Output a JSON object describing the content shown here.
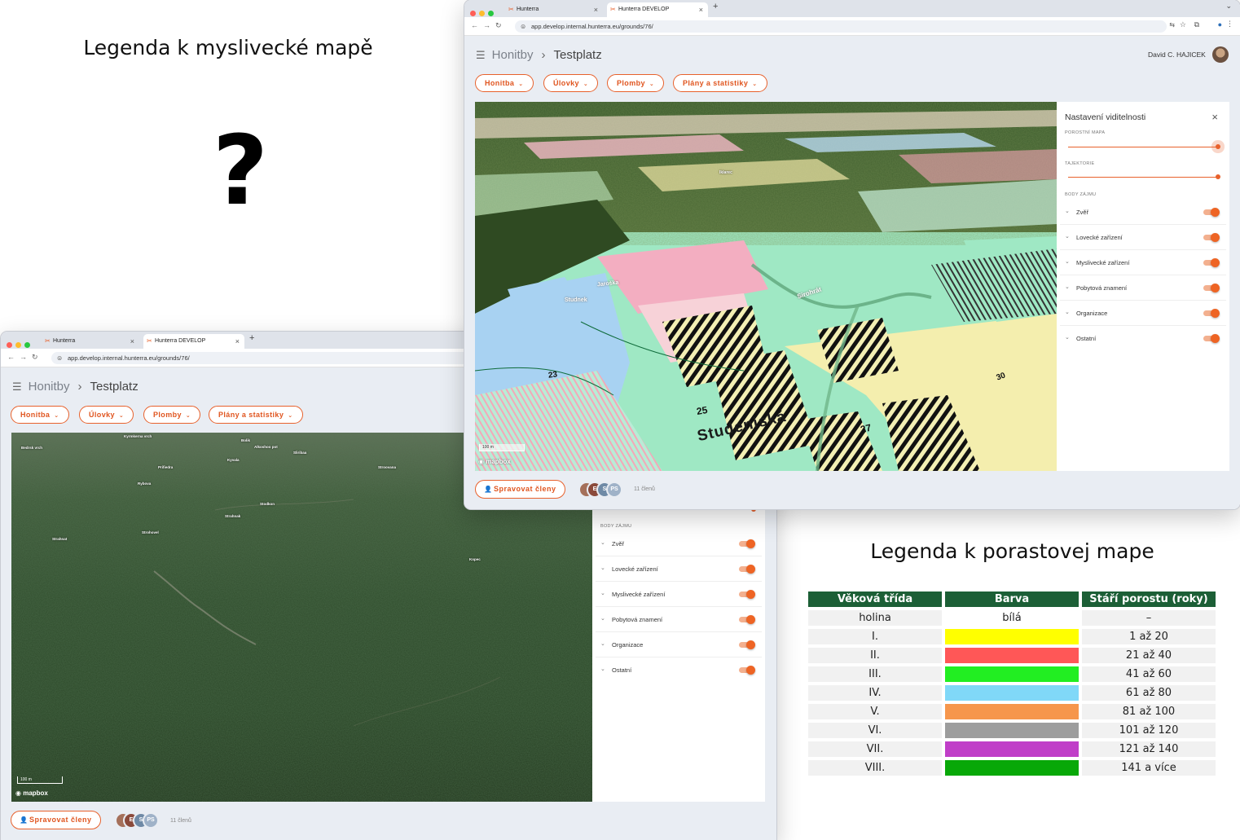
{
  "headings": {
    "left_title": "Legenda k myslivecké mapě",
    "question_mark": "?",
    "right_title": "Legenda k porastovej mape"
  },
  "colors": {
    "accent": "#e8612c",
    "table_header": "#1c5f36"
  },
  "browser_back": {
    "tabs": [
      {
        "label": "Hunterra",
        "icon": "hunterra-logo-icon"
      },
      {
        "label": "Hunterra DEVELOP",
        "icon": "hunterra-logo-icon"
      }
    ],
    "url": "app.develop.internal.hunterra.eu/grounds/76/"
  },
  "browser_front": {
    "tabs": [
      {
        "label": "Hunterra",
        "icon": "hunterra-logo-icon"
      },
      {
        "label": "Hunterra DEVELOP",
        "icon": "hunterra-logo-icon"
      }
    ],
    "url": "app.develop.internal.hunterra.eu/grounds/76/",
    "user_name": "David C. HAJICEK"
  },
  "app": {
    "breadcrumb": {
      "root": "Honitby",
      "current": "Testplatz"
    },
    "menu": [
      {
        "label": "Honitba"
      },
      {
        "label": "Úlovky"
      },
      {
        "label": "Plomby"
      },
      {
        "label": "Plány a statistiky"
      }
    ],
    "manage_members_label": "Spravovat členy",
    "members_count": "11 členů",
    "member_initials": [
      "E",
      "S",
      "PS"
    ],
    "scale_label": "100 m",
    "mapbox_label": "mapbox"
  },
  "visibility_panel": {
    "title": "Nastavení viditelnosti",
    "layers": [
      {
        "label": "POROSTNÍ MAPA",
        "value": 1.0
      },
      {
        "label": "TAJEKTORIE",
        "value": 1.0
      }
    ],
    "poi_label": "BODY ZÁJMU",
    "poi": [
      {
        "label": "Zvěř",
        "on": true
      },
      {
        "label": "Lovecké zařízení",
        "on": true
      },
      {
        "label": "Myslivecké zařízení",
        "on": true
      },
      {
        "label": "Pobytová znamení",
        "on": true
      },
      {
        "label": "Organizace",
        "on": true
      },
      {
        "label": "Ostatní",
        "on": true
      }
    ]
  },
  "map_labels_satellite": [
    "Bedrsk vrch",
    "Kyrmkerna vrch",
    "Bolik",
    "Alkoshoo pot",
    "Sliribaa",
    "Kyvala",
    "Prifiedra",
    "Stroovana",
    "Rybova",
    "Strahnak",
    "Stodkon",
    "Kopec",
    "Strohovel",
    "Strahnat"
  ],
  "map_labels_stand": [
    "23",
    "25",
    "27",
    "30",
    "Studeniská",
    "Jaroška",
    "Studnek",
    "Sirohrát",
    "Iklarec"
  ],
  "legend_table": {
    "headers": [
      "Věková třída",
      "Barva",
      "Stáří porostu (roky)"
    ],
    "rows": [
      {
        "class": "holina",
        "color_text": "bílá",
        "color": "",
        "age": "–"
      },
      {
        "class": "I.",
        "color_text": "",
        "color": "#ffff00",
        "age": "1 až 20"
      },
      {
        "class": "II.",
        "color_text": "",
        "color": "#ff5757",
        "age": "21 až 40"
      },
      {
        "class": "III.",
        "color_text": "",
        "color": "#22ee22",
        "age": "41 až 60"
      },
      {
        "class": "IV.",
        "color_text": "",
        "color": "#80d8f8",
        "age": "61 až 80"
      },
      {
        "class": "V.",
        "color_text": "",
        "color": "#f6964c",
        "age": "81 až 100"
      },
      {
        "class": "VI.",
        "color_text": "",
        "color": "#9d9d9d",
        "age": "101 až 120"
      },
      {
        "class": "VII.",
        "color_text": "",
        "color": "#c03ec8",
        "age": "121 až 140"
      },
      {
        "class": "VIII.",
        "color_text": "",
        "color": "#08a808",
        "age": "141 a více"
      }
    ]
  }
}
